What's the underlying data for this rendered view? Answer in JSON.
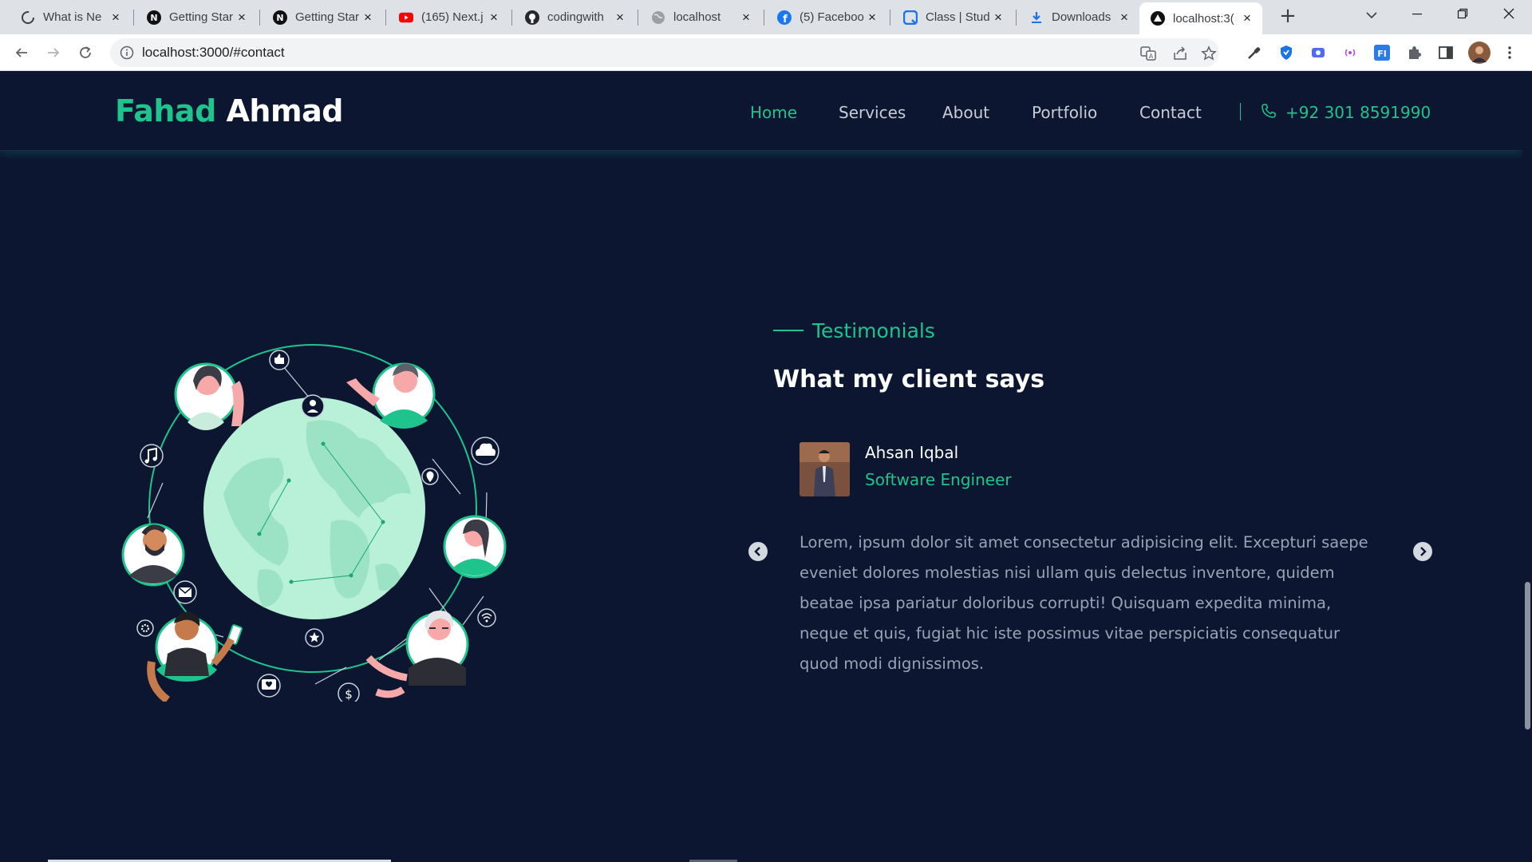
{
  "browser": {
    "tabs": [
      {
        "title": "What is Ne",
        "icon": "loading-icon"
      },
      {
        "title": "Getting Star",
        "icon": "nextjs-icon"
      },
      {
        "title": "Getting Star",
        "icon": "nextjs-icon"
      },
      {
        "title": "(165) Next.j",
        "icon": "youtube-icon"
      },
      {
        "title": "codingwith",
        "icon": "github-icon"
      },
      {
        "title": "localhost",
        "icon": "globe-icon"
      },
      {
        "title": "(5) Faceboo",
        "icon": "facebook-icon"
      },
      {
        "title": "Class | Stud",
        "icon": "class-icon"
      },
      {
        "title": "Downloads",
        "icon": "download-icon"
      },
      {
        "title": "localhost:3(",
        "icon": "vercel-icon",
        "active": true
      }
    ],
    "url": "localhost:3000/#contact"
  },
  "site": {
    "logo": {
      "first": "Fahad",
      "last": "Ahmad"
    },
    "nav": [
      {
        "label": "Home",
        "active": true
      },
      {
        "label": "Services"
      },
      {
        "label": "About"
      },
      {
        "label": "Portfolio"
      },
      {
        "label": "Contact"
      }
    ],
    "phone": "+92 301 8591990",
    "accent": "#1ec48b",
    "background": "#0c1631"
  },
  "testimonials": {
    "kicker": "Testimonials",
    "heading": "What my client says",
    "client": {
      "name": "Ahsan Iqbal",
      "role": "Software Engineer"
    },
    "quote": "Lorem, ipsum dolor sit amet consectetur adipisicing elit. Excepturi saepe eveniet dolores molestias nisi ullam quis delectus inventore, quidem beatae ipsa pariatur doloribus corrupti! Quisquam expedita minima, neque et quis, fugiat hic iste possimus vitae perspiciatis consequatur quod modi dignissimos."
  }
}
